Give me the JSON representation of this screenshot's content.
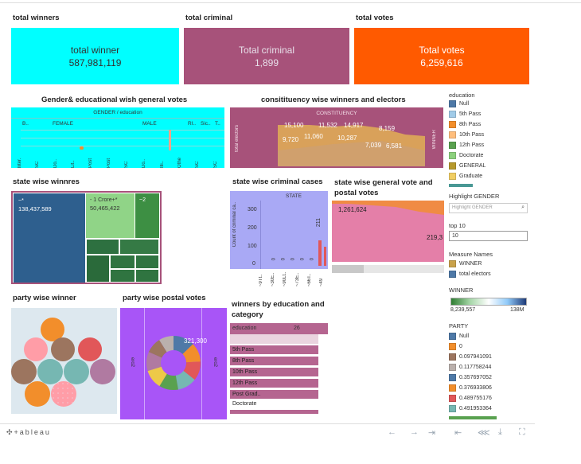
{
  "kpis": {
    "winners": {
      "section_title": "total winners",
      "label": "total winner",
      "value": "587,981,119",
      "color": "#00ffff",
      "text_color": "#333333"
    },
    "criminal": {
      "section_title": "total criminal",
      "label": "Total criminal",
      "value": "1,899",
      "color": "#a7527a",
      "text_color": "#e8e0ea"
    },
    "votes": {
      "section_title": "total votes",
      "label": "Total votes",
      "value": "6,259,616",
      "color": "#ff5a00",
      "text_color": "#ffffff"
    }
  },
  "gender_chart": {
    "title": "Gender& educational wish general votes",
    "header": "GENDER / education",
    "col_labels": [
      "B..",
      "FEMALE",
      "MALE",
      "RI..",
      "Sic..",
      "T.."
    ],
    "x_labels": [
      "lliter.",
      "SC",
      "Do..",
      "Lit..",
      "Post",
      "Post",
      "SC",
      "Do..",
      "Illi..",
      "Othe",
      "SC",
      "SC"
    ]
  },
  "constituency_chart": {
    "title": "consitituency wise winners and electors",
    "header": "CONSTITUENCY",
    "y_label": "total electors",
    "right_label": "WINNER",
    "labels_top": [
      "15,100",
      "11,532",
      "14,917",
      "8,159"
    ],
    "labels_mid": [
      "9,720",
      "11,060",
      "10,287"
    ],
    "labels_low": [
      "7,039",
      "6,581"
    ]
  },
  "treemap": {
    "title": "state wise winnres",
    "blocks": [
      {
        "label": "~*",
        "value": "138,437,589"
      },
      {
        "label": "- 1 Crore+*",
        "value": "50,465,422"
      },
      {
        "label": "~2",
        "value": ""
      }
    ]
  },
  "criminal_chart": {
    "title": "state wise criminal cases",
    "header": "STATE",
    "y_label": "Count of criminal ca..",
    "y_ticks": [
      "300",
      "200",
      "100",
      "0"
    ],
    "bar_value": "211",
    "zero_labels": [
      "0",
      "0",
      "0",
      "0",
      "0"
    ],
    "x_labels": [
      "~9Tt..",
      "~30E..",
      "~90Lt..",
      "~73E..",
      "~66T..",
      "~49"
    ]
  },
  "postal_chart": {
    "title": "state wise general vote and postal votes",
    "value_left": "1,261,624",
    "value_right": "219,3"
  },
  "legend": {
    "education_title": "education",
    "education_items": [
      {
        "label": "Null",
        "color": "#4e79a7"
      },
      {
        "label": "5th Pass",
        "color": "#a0cbe8"
      },
      {
        "label": "8th Pass",
        "color": "#f28e2b"
      },
      {
        "label": "10th Pass",
        "color": "#ffbe7d"
      },
      {
        "label": "12th Pass",
        "color": "#59a14f"
      },
      {
        "label": "Doctorate",
        "color": "#8cd17d"
      },
      {
        "label": "GENERAL",
        "color": "#b6992d"
      },
      {
        "label": "Graduate",
        "color": "#f1ce63"
      }
    ],
    "highlight_title": "Highlight GENDER",
    "highlight_placeholder": "Highlight GENDER",
    "top_title": "top 10",
    "top_value": "10",
    "measure_title": "Measure Names",
    "measure_items": [
      {
        "label": "WINNER",
        "color": "#c9a24a"
      },
      {
        "label": "total electors",
        "color": "#4e79a7"
      }
    ],
    "winner_title": "WINNER",
    "winner_min": "8,239,557",
    "winner_max": "138M",
    "party_title": "PARTY",
    "party_items": [
      {
        "label": "Null",
        "color": "#4e79a7"
      },
      {
        "label": "0",
        "color": "#f28e2b"
      },
      {
        "label": "0.097941091",
        "color": "#9c755f"
      },
      {
        "label": "0.117758244",
        "color": "#bab0ac"
      },
      {
        "label": "0.357697052",
        "color": "#4e79a7"
      },
      {
        "label": "0.376933806",
        "color": "#f28e2b"
      },
      {
        "label": "0.489755176",
        "color": "#e15759"
      },
      {
        "label": "0.491953364",
        "color": "#76b7b2"
      }
    ]
  },
  "party_winner": {
    "title": "party wise winner"
  },
  "party_postal": {
    "title": "party wise postal votes",
    "value": "321,300",
    "side_label": "ero2"
  },
  "edu_table": {
    "title": "winners by education and category",
    "header": "education",
    "header_value": "26",
    "rows": [
      "5th Pass",
      "8th Pass",
      "10th Pass",
      "12th Pass",
      "Post Grad..",
      "Doctorate"
    ]
  },
  "footer": {
    "brand": "+ableau"
  }
}
